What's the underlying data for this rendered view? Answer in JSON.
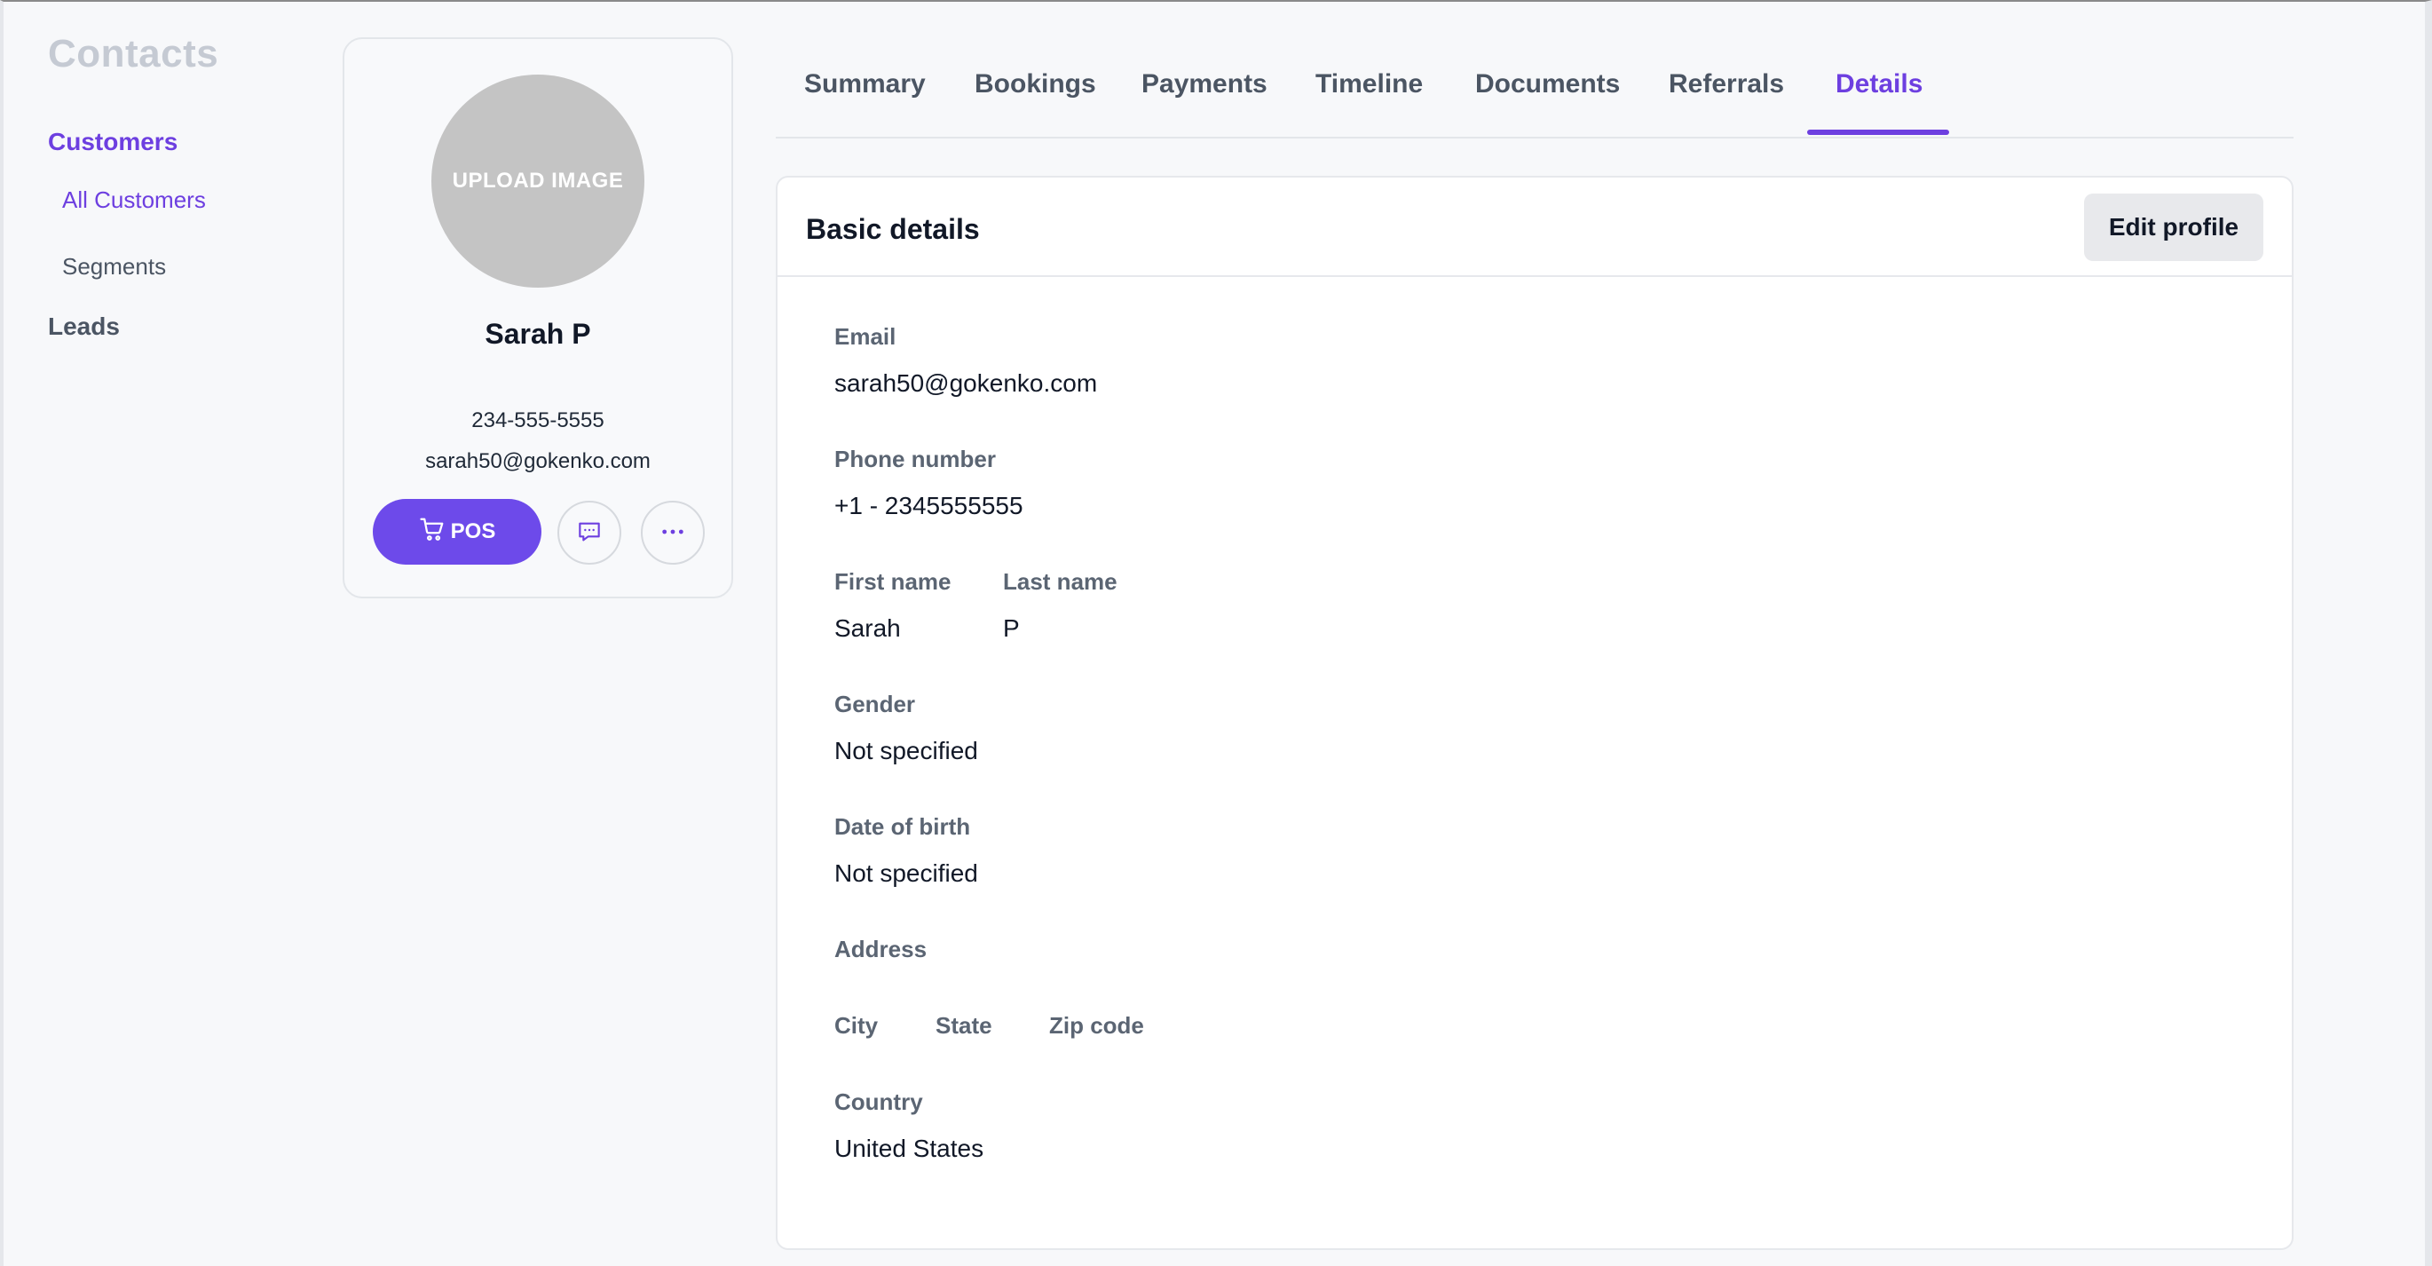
{
  "sidebar": {
    "title": "Contacts",
    "sections": [
      {
        "label": "Customers",
        "items": [
          {
            "label": "All Customers"
          },
          {
            "label": "Segments"
          }
        ]
      },
      {
        "label": "Leads"
      }
    ]
  },
  "profile": {
    "avatar_text": "UPLOAD IMAGE",
    "name": "Sarah P",
    "phone": "234-555-5555",
    "email": "sarah50@gokenko.com",
    "pos_label": "POS",
    "icons": {
      "cart": "cart-icon",
      "chat": "chat-bubble-icon",
      "more": "more-horizontal-icon"
    }
  },
  "tabs": [
    "Summary",
    "Bookings",
    "Payments",
    "Timeline",
    "Documents",
    "Referrals",
    "Details"
  ],
  "active_tab": "Details",
  "details": {
    "title": "Basic details",
    "edit_label": "Edit profile",
    "email_label": "Email",
    "email_value": "sarah50@gokenko.com",
    "phone_label": "Phone number",
    "phone_value": "+1 - 2345555555",
    "first_name_label": "First name",
    "first_name_value": "Sarah",
    "last_name_label": "Last name",
    "last_name_value": "P",
    "gender_label": "Gender",
    "gender_value": "Not specified",
    "dob_label": "Date of birth",
    "dob_value": "Not specified",
    "address_label": "Address",
    "city_label": "City",
    "state_label": "State",
    "zip_label": "Zip code",
    "country_label": "Country",
    "country_value": "United States"
  },
  "colors": {
    "accent": "#6d3fe0",
    "button": "#6d4aea",
    "muted": "#c5cad3"
  }
}
